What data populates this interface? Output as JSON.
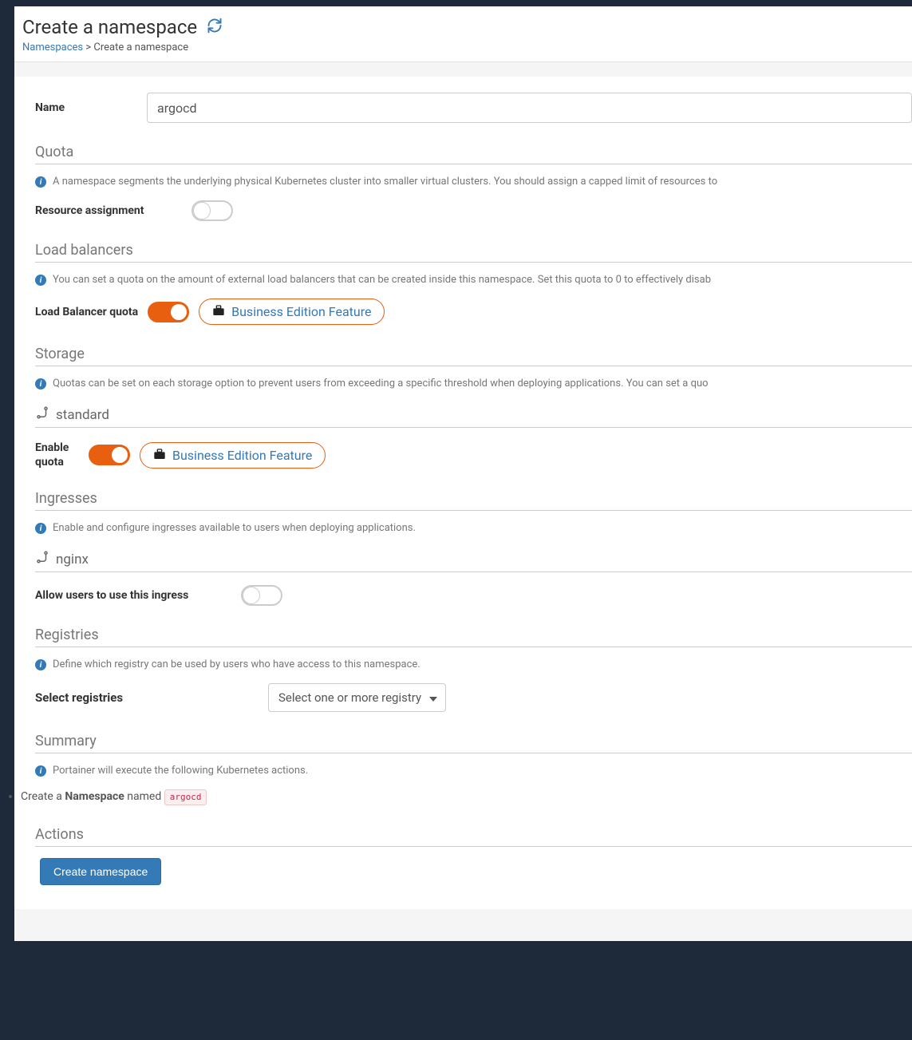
{
  "header": {
    "title": "Create a namespace",
    "breadcrumb_link": "Namespaces",
    "breadcrumb_sep": " > ",
    "breadcrumb_current": "Create a namespace"
  },
  "form": {
    "name_label": "Name",
    "name_value": "argocd"
  },
  "quota": {
    "section": "Quota",
    "info": "A namespace segments the underlying physical Kubernetes cluster into smaller virtual clusters. You should assign a capped limit of resources to",
    "resource_assignment_label": "Resource assignment",
    "resource_assignment_on": false
  },
  "loadbalancers": {
    "section": "Load balancers",
    "info": "You can set a quota on the amount of external load balancers that can be created inside this namespace. Set this quota to 0 to effectively disab",
    "quota_label": "Load Balancer quota",
    "quota_on": true,
    "be_label": "Business Edition Feature"
  },
  "storage": {
    "section": "Storage",
    "info": "Quotas can be set on each storage option to prevent users from exceeding a specific threshold when deploying applications. You can set a quo",
    "class_name": "standard",
    "enable_quota_label": "Enable quota",
    "enable_quota_on": true,
    "be_label": "Business Edition Feature"
  },
  "ingresses": {
    "section": "Ingresses",
    "info": "Enable and configure ingresses available to users when deploying applications.",
    "controller_name": "nginx",
    "allow_label": "Allow users to use this ingress",
    "allow_on": false
  },
  "registries": {
    "section": "Registries",
    "info": "Define which registry can be used by users who have access to this namespace.",
    "select_label": "Select registries",
    "select_placeholder": "Select one or more registry"
  },
  "summary": {
    "section": "Summary",
    "info": "Portainer will execute the following Kubernetes actions.",
    "line_prefix": "Create a ",
    "line_strong": "Namespace",
    "line_mid": " named ",
    "namespace_name": "argocd"
  },
  "actions": {
    "section": "Actions",
    "create_button": "Create namespace"
  }
}
